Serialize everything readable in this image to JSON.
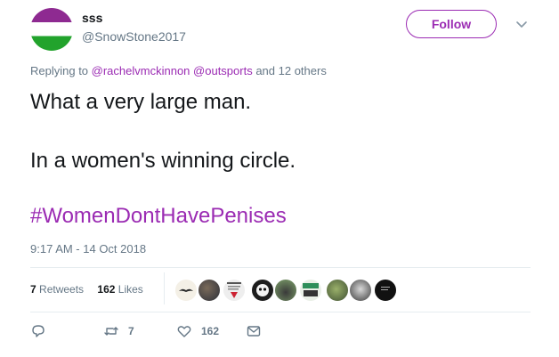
{
  "author": {
    "display_name": "sss",
    "handle": "@SnowStone2017"
  },
  "follow_label": "Follow",
  "reply_context": {
    "prefix": "Replying to ",
    "mention_1": "@rachelvmckinnon",
    "mention_2": "@outsports",
    "suffix": " and 12 others"
  },
  "tweet": {
    "line1": "What a very large man.",
    "line2": "In a women's winning circle.",
    "hashtag": "#WomenDontHavePenises"
  },
  "timestamp": "9:17 AM - 14 Oct 2018",
  "stats": {
    "retweets_count": "7",
    "retweets_label": "Retweets",
    "likes_count": "162",
    "likes_label": "Likes"
  },
  "likers": [
    {
      "name": "mustache-avatar"
    },
    {
      "name": "dark-avatar"
    },
    {
      "name": "text-flyer-avatar"
    },
    {
      "name": "mask-avatar"
    },
    {
      "name": "eagle-avatar"
    },
    {
      "name": "sign-avatar"
    },
    {
      "name": "green-avatar"
    },
    {
      "name": "portrait-avatar"
    },
    {
      "name": "black-avatar"
    }
  ],
  "actions": {
    "reply_count": "",
    "retweet_count": "7",
    "like_count": "162"
  },
  "colors": {
    "accent": "#9b2bb3",
    "muted": "#657786"
  }
}
